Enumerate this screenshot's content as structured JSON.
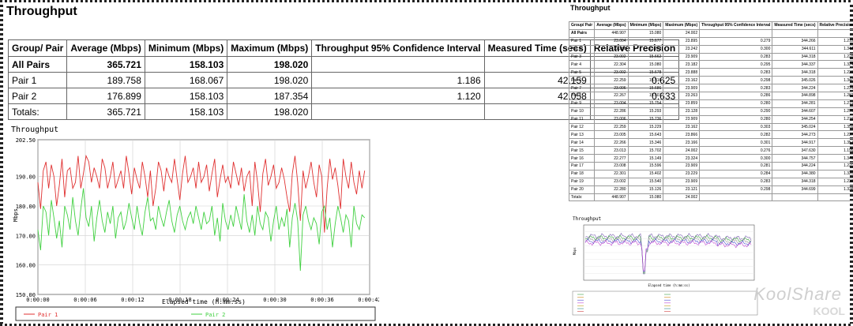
{
  "report": {
    "title": "Throughput",
    "headers": [
      "Group/ Pair",
      "Average (Mbps)",
      "Minimum (Mbps)",
      "Maximum (Mbps)",
      "Throughput 95% Confidence Interval",
      "Measured Time (secs)",
      "Relative Precision"
    ],
    "rows": [
      {
        "name": "All Pairs",
        "avg": "365.721",
        "min": "158.103",
        "max": "198.020",
        "ci": "",
        "time": "",
        "rp": "",
        "bold": true
      },
      {
        "name": "Pair 1",
        "avg": "189.758",
        "min": "168.067",
        "max": "198.020",
        "ci": "1.186",
        "time": "42.159",
        "rp": "0.625",
        "bold": false
      },
      {
        "name": "Pair 2",
        "avg": "176.899",
        "min": "158.103",
        "max": "187.354",
        "ci": "1.120",
        "time": "42.058",
        "rp": "0.633",
        "bold": false
      },
      {
        "name": "Totals:",
        "avg": "365.721",
        "min": "158.103",
        "max": "198.020",
        "ci": "",
        "time": "",
        "rp": "",
        "bold": false
      }
    ]
  },
  "chart_data": {
    "type": "line",
    "title": "Throughput",
    "xlabel": "Elapsed time (h:mm:ss)",
    "ylabel": "Mbps",
    "ylim": [
      150,
      202.5
    ],
    "yticks": [
      "202.50",
      "190.00",
      "180.00",
      "170.00",
      "160.00",
      "150.00"
    ],
    "ytick_values": [
      202.5,
      190,
      180,
      170,
      160,
      150
    ],
    "xlim": [
      0,
      42
    ],
    "xticks": [
      "0:00:00",
      "0:00:06",
      "0:00:12",
      "0:00:18",
      "0:00:24",
      "0:00:30",
      "0:00:36",
      "0:00:42"
    ],
    "xtick_values": [
      0,
      6,
      12,
      18,
      24,
      30,
      36,
      42
    ],
    "grid": true,
    "legend_position": "bottom",
    "series": [
      {
        "name": "Pair 1",
        "color": "#e03030",
        "values": [
          188,
          179,
          192,
          195,
          186,
          194,
          190,
          180,
          187,
          196,
          183,
          192,
          193,
          186,
          188,
          197,
          186,
          191,
          197,
          195,
          188,
          193,
          190,
          186,
          196,
          193,
          186,
          190,
          195,
          186,
          189,
          192,
          186,
          197,
          191,
          184,
          193,
          189,
          186,
          195,
          190,
          183,
          192,
          180,
          186,
          195,
          192,
          185,
          193,
          190,
          188,
          196,
          189,
          182,
          191,
          197,
          188,
          190,
          193,
          186,
          195,
          188,
          190,
          194,
          185,
          191,
          196,
          183,
          189,
          194,
          188,
          190,
          186,
          195,
          191,
          187,
          193,
          185,
          190,
          192,
          180,
          195,
          188,
          178,
          191,
          196,
          187,
          190,
          194,
          186,
          188,
          193,
          189,
          183,
          178,
          191,
          197,
          188,
          175,
          192,
          186,
          190,
          195,
          188,
          183,
          194,
          190,
          171,
          186,
          196,
          189,
          193,
          187,
          179,
          196,
          190,
          186,
          195,
          188,
          184,
          192,
          186,
          192
        ]
      },
      {
        "name": "Pair 2",
        "color": "#40d040",
        "values": [
          172,
          165,
          180,
          178,
          170,
          182,
          176,
          169,
          175,
          166,
          180,
          177,
          172,
          183,
          175,
          170,
          179,
          186,
          176,
          173,
          180,
          168,
          176,
          182,
          175,
          171,
          178,
          174,
          180,
          169,
          176,
          178,
          172,
          175,
          181,
          176,
          172,
          180,
          174,
          170,
          178,
          183,
          175,
          176,
          172,
          180,
          176,
          173,
          178,
          182,
          175,
          171,
          177,
          180,
          175,
          172,
          176,
          178,
          174,
          180,
          176,
          172,
          178,
          174,
          175,
          180,
          170,
          176,
          168,
          181,
          175,
          172,
          177,
          173,
          180,
          176,
          172,
          184,
          175,
          171,
          177,
          170,
          180,
          174,
          172,
          178,
          176,
          168,
          175,
          180,
          172,
          176,
          173,
          179,
          166,
          176,
          181,
          175,
          158,
          177,
          180,
          175,
          172,
          176,
          174,
          167,
          178,
          180,
          172,
          176,
          166,
          174,
          180,
          176,
          171,
          177,
          175,
          166,
          180,
          174,
          172,
          177,
          176
        ]
      }
    ]
  },
  "mini": {
    "title": "Throughput",
    "headers": [
      "Group/ Pair",
      "Average (Mbps)",
      "Minimum (Mbps)",
      "Maximum (Mbps)",
      "Throughput 95% Confidence Interval",
      "Measured Time (secs)",
      "Relative Precision"
    ],
    "rows": [
      [
        "All Pairs",
        "448.907",
        "15.080",
        "24.002",
        "",
        "",
        ""
      ],
      [
        "Pair 1",
        "23.004",
        "15.677",
        "23.895",
        "0.279",
        "344.266",
        "1.212"
      ],
      [
        "Pair 2",
        "22.286",
        "15.273",
        "23.242",
        "0.300",
        "344.611",
        "1.344"
      ],
      [
        "Pair 3",
        "23.002",
        "15.662",
        "23.909",
        "0.283",
        "344.318",
        "1.228"
      ],
      [
        "Pair 4",
        "22.304",
        "15.080",
        "23.182",
        "0.295",
        "344.337",
        "1.324"
      ],
      [
        "Pair 5",
        "23.002",
        "15.678",
        "23.888",
        "0.283",
        "344.318",
        "1.229"
      ],
      [
        "Pair 6",
        "22.259",
        "15.516",
        "23.162",
        "0.298",
        "345.026",
        "1.340"
      ],
      [
        "Pair 7",
        "23.006",
        "15.686",
        "23.909",
        "0.283",
        "344.224",
        "1.231"
      ],
      [
        "Pair 8",
        "22.267",
        "15.507",
        "23.263",
        "0.286",
        "344.898",
        "1.282"
      ],
      [
        "Pair 9",
        "23.004",
        "15.754",
        "23.859",
        "0.280",
        "344.281",
        "1.219"
      ],
      [
        "Pair 10",
        "22.286",
        "15.293",
        "23.128",
        "0.290",
        "344.607",
        "1.299"
      ],
      [
        "Pair 11",
        "23.006",
        "15.736",
        "23.909",
        "0.280",
        "344.254",
        "1.216"
      ],
      [
        "Pair 12",
        "22.259",
        "15.229",
        "23.162",
        "0.303",
        "345.024",
        "1.359"
      ],
      [
        "Pair 13",
        "23.005",
        "15.643",
        "23.866",
        "0.282",
        "344.273",
        "1.227"
      ],
      [
        "Pair 14",
        "22.266",
        "15.346",
        "23.166",
        "0.301",
        "344.917",
        "1.351"
      ],
      [
        "Pair 15",
        "23.013",
        "15.702",
        "24.002",
        "0.276",
        "347.630",
        "1.199"
      ],
      [
        "Pair 16",
        "22.277",
        "15.149",
        "23.324",
        "0.300",
        "344.757",
        "1.349"
      ],
      [
        "Pair 17",
        "23.008",
        "15.596",
        "23.909",
        "0.281",
        "344.224",
        "1.220"
      ],
      [
        "Pair 18",
        "22.301",
        "15.402",
        "23.229",
        "0.284",
        "344.380",
        "1.320"
      ],
      [
        "Pair 19",
        "23.002",
        "15.540",
        "23.909",
        "0.283",
        "344.318",
        "1.230"
      ],
      [
        "Pair 20",
        "22.280",
        "15.126",
        "23.121",
        "0.298",
        "344.699",
        "1.338"
      ],
      [
        "Totals:",
        "448.907",
        "15.080",
        "24.002",
        "",
        "",
        ""
      ]
    ],
    "chart_title": "Throughput",
    "chart_xlabel": "Elapsed time (h:mm:ss)",
    "chart_ylabel": "Mbps"
  },
  "watermark": {
    "text": "KoolShare",
    "text2": "KOOL"
  }
}
